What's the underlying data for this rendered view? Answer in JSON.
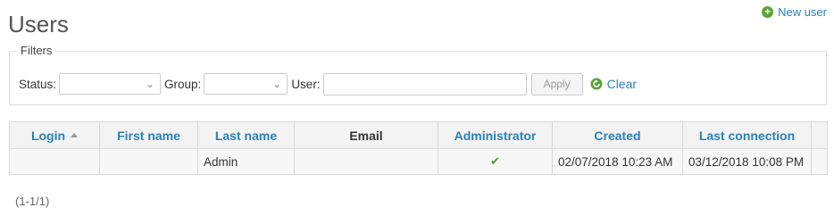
{
  "page": {
    "title": "Users"
  },
  "actions": {
    "new_user_label": "New user",
    "new_user_icon": "add-icon"
  },
  "filters": {
    "legend": "Filters",
    "status_label": "Status:",
    "status_value": "",
    "group_label": "Group:",
    "group_value": "",
    "user_label": "User:",
    "user_value": "",
    "apply_label": "Apply",
    "clear_label": "Clear",
    "clear_icon": "refresh-icon"
  },
  "table": {
    "columns": [
      {
        "label": "Login",
        "sortable": true,
        "sorted": "asc"
      },
      {
        "label": "First name",
        "sortable": true
      },
      {
        "label": "Last name",
        "sortable": true
      },
      {
        "label": "Email",
        "sortable": false
      },
      {
        "label": "Administrator",
        "sortable": true
      },
      {
        "label": "Created",
        "sortable": true
      },
      {
        "label": "Last connection",
        "sortable": true
      }
    ],
    "rows": [
      {
        "login": "",
        "first_name": "",
        "last_name": "Admin",
        "email": "",
        "administrator": "✔",
        "created": "02/07/2018 10:23 AM",
        "last_connection": "03/12/2018 10:08 PM"
      }
    ]
  },
  "pagination": {
    "summary": "(1-1/1)"
  },
  "colors": {
    "link": "#2a7fb8",
    "accent_green": "#5aa43a"
  }
}
